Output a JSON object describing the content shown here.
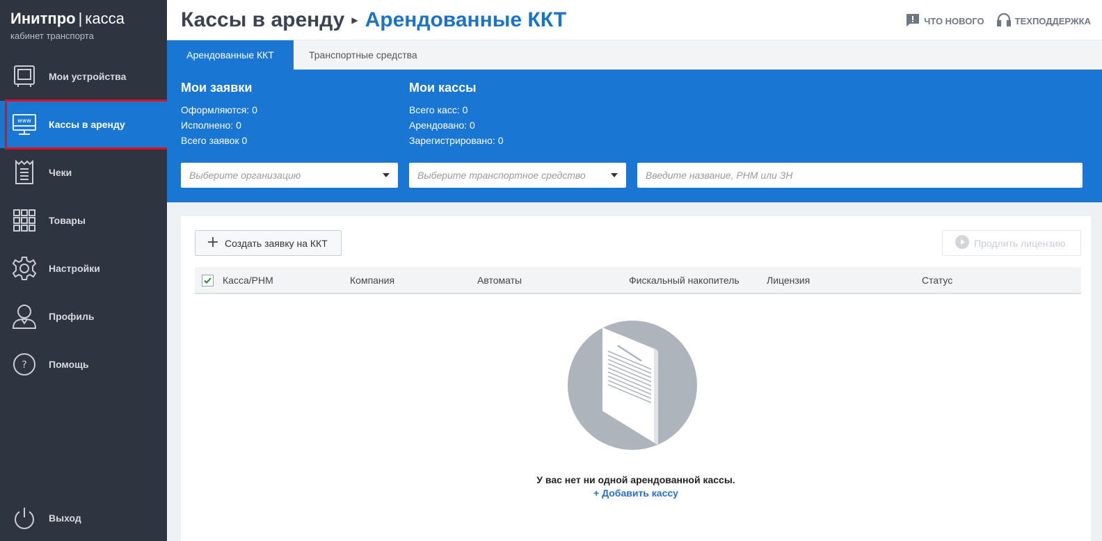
{
  "brand": {
    "name": "Инитпро",
    "separator": "|",
    "product": "касса",
    "subtitle": "кабинет транспорта"
  },
  "sidebar": {
    "items": [
      {
        "label": "Мои устройства",
        "icon": "device-icon"
      },
      {
        "label": "Кассы в аренду",
        "icon": "www-monitor-icon",
        "active": true
      },
      {
        "label": "Чеки",
        "icon": "receipt-icon"
      },
      {
        "label": "Товары",
        "icon": "grid-icon"
      },
      {
        "label": "Настройки",
        "icon": "gear-icon"
      },
      {
        "label": "Профиль",
        "icon": "user-icon"
      },
      {
        "label": "Помощь",
        "icon": "help-icon"
      }
    ],
    "logout": {
      "label": "Выход",
      "icon": "power-icon"
    }
  },
  "header": {
    "breadcrumb_parent": "Кассы в аренду",
    "breadcrumb_current": "Арендованные ККТ",
    "whats_new": "ЧТО НОВОГО",
    "support": "ТЕХПОДДЕРЖКА"
  },
  "tabs": [
    {
      "label": "Арендованные ККТ",
      "active": true
    },
    {
      "label": "Транспортные средства",
      "active": false
    }
  ],
  "requests": {
    "title": "Мои заявки",
    "rows": [
      "Оформляются: 0",
      "Исполнено: 0",
      "Всего заявок 0"
    ]
  },
  "kassas": {
    "title": "Мои кассы",
    "rows": [
      "Всего касс: 0",
      "Арендовано: 0",
      "Зарегистрировано: 0"
    ]
  },
  "filters": {
    "organization_placeholder": "Выберите организацию",
    "vehicle_placeholder": "Выберите транспортное средство",
    "search_placeholder": "Введите название, РНМ или ЗН"
  },
  "actions": {
    "create": "Создать заявку на ККТ",
    "renew": "Продлить лицензию"
  },
  "table": {
    "columns": [
      "Касса/РНМ",
      "Компания",
      "Автоматы",
      "Фискальный накопитель",
      "Лицензия",
      "Статус"
    ],
    "select_all_checked": true
  },
  "empty_state": {
    "message": "У вас нет ни одной арендованной кассы.",
    "link": "+ Добавить кассу"
  },
  "colors": {
    "sidebar": "#2f3441",
    "accent": "#1976d2",
    "highlight": "#e0101e",
    "link": "#2a6fc9"
  }
}
